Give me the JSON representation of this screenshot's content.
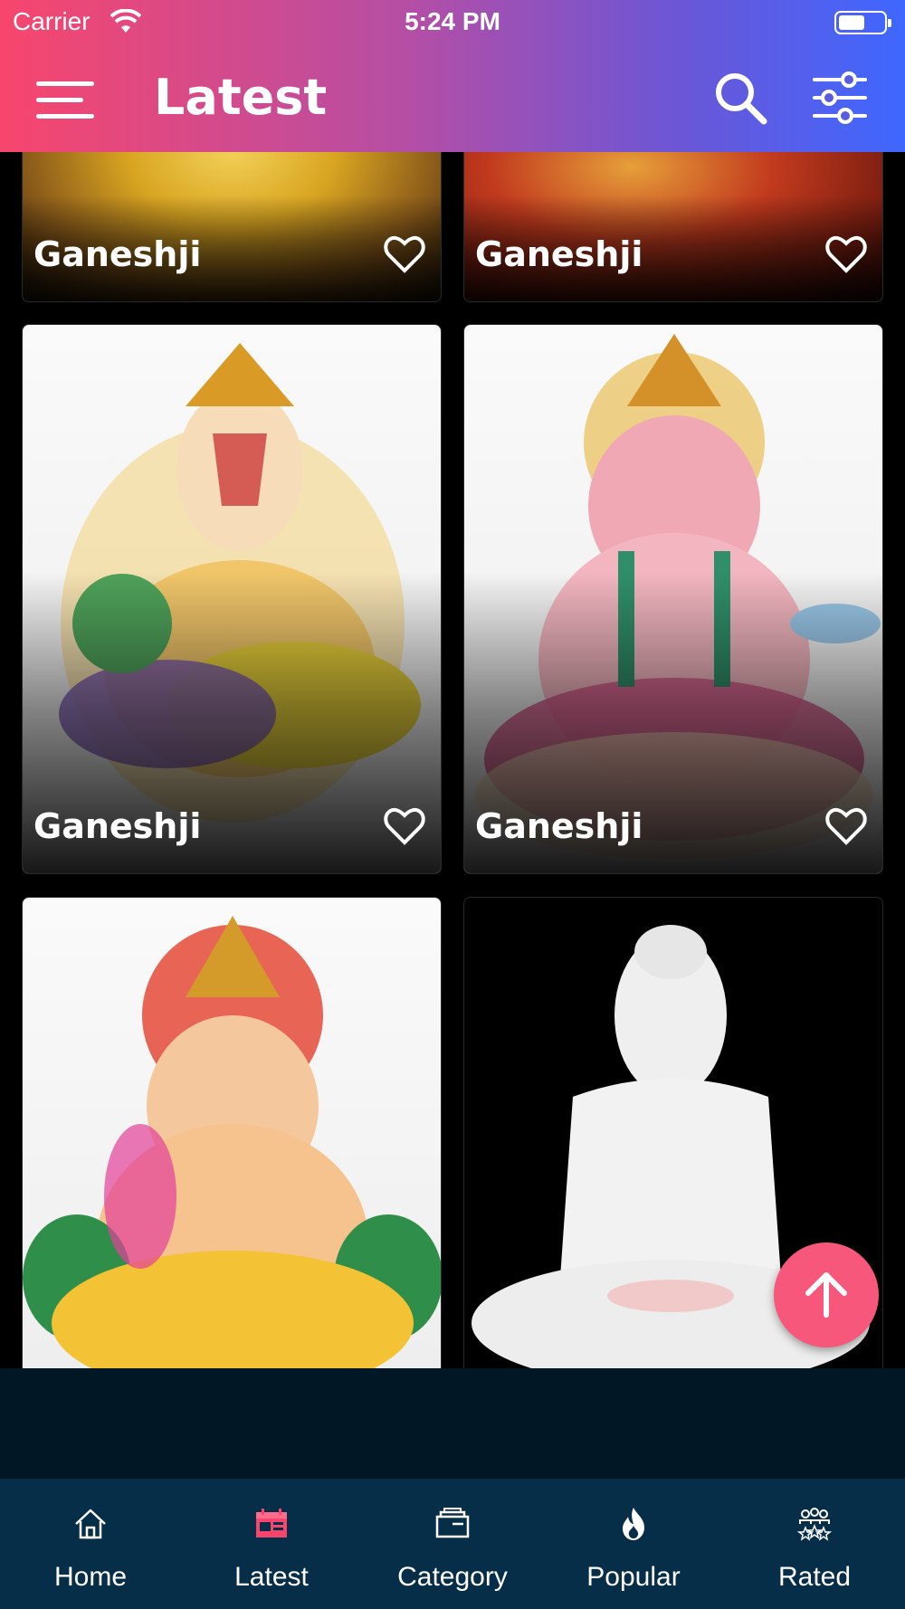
{
  "status_bar": {
    "carrier": "Carrier",
    "time": "5:24 PM"
  },
  "header": {
    "title": "Latest"
  },
  "cards": [
    {
      "label": "Ganeshji"
    },
    {
      "label": "Ganeshji"
    },
    {
      "label": "Ganeshji"
    },
    {
      "label": "Ganeshji"
    },
    {
      "label": ""
    },
    {
      "label": ""
    }
  ],
  "tabs": [
    {
      "label": "Home",
      "icon": "home-icon"
    },
    {
      "label": "Latest",
      "icon": "latest-icon"
    },
    {
      "label": "Category",
      "icon": "category-icon"
    },
    {
      "label": "Popular",
      "icon": "popular-icon"
    },
    {
      "label": "Rated",
      "icon": "rated-icon"
    }
  ],
  "colors": {
    "header_gradient_start": "#f7466d",
    "header_gradient_end": "#3f67ff",
    "fab": "#f7577a",
    "tabbar_bg": "#072e48",
    "active_tab": "#f7466d"
  }
}
